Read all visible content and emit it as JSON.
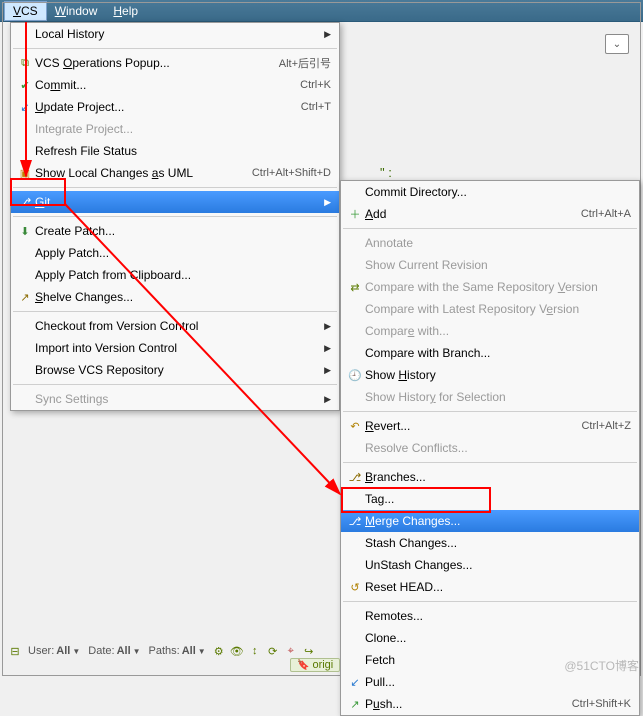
{
  "menubar": {
    "vcs": "VCS",
    "window": "Window",
    "help": "Help"
  },
  "vcs_menu": {
    "local_history": "Local History",
    "vcs_ops": "VCS Operations Popup...",
    "vcs_ops_sc": "Alt+后引号",
    "commit": "Commit...",
    "commit_sc": "Ctrl+K",
    "update": "Update Project...",
    "update_sc": "Ctrl+T",
    "integrate": "Integrate Project...",
    "refresh": "Refresh File Status",
    "uml": "Show Local Changes as UML",
    "uml_sc": "Ctrl+Alt+Shift+D",
    "git": "Git",
    "create_patch": "Create Patch...",
    "apply_patch": "Apply Patch...",
    "apply_clip": "Apply Patch from Clipboard...",
    "shelve": "Shelve Changes...",
    "checkout_vc": "Checkout from Version Control",
    "import_vc": "Import into Version Control",
    "browse_repo": "Browse VCS Repository",
    "sync": "Sync Settings"
  },
  "git_menu": {
    "commit_dir": "Commit Directory...",
    "add": "Add",
    "add_sc": "Ctrl+Alt+A",
    "annotate": "Annotate",
    "show_cur": "Show Current Revision",
    "cmp_same": "Compare with the Same Repository Version",
    "cmp_latest": "Compare with Latest Repository Version",
    "cmp_with": "Compare with...",
    "cmp_branch": "Compare with Branch...",
    "show_hist": "Show History",
    "show_hist_sel": "Show History for Selection",
    "revert": "Revert...",
    "revert_sc": "Ctrl+Alt+Z",
    "resolve": "Resolve Conflicts...",
    "branches": "Branches...",
    "tag": "Tag...",
    "merge": "Merge Changes...",
    "stash": "Stash Changes...",
    "unstash": "UnStash Changes...",
    "reset": "Reset HEAD...",
    "remotes": "Remotes...",
    "clone": "Clone...",
    "fetch": "Fetch",
    "pull": "Pull...",
    "push": "Push...",
    "push_sc": "Ctrl+Shift+K"
  },
  "bottom": {
    "user": "User:",
    "all": "All",
    "date": "Date:",
    "paths": "Paths:"
  },
  "bg_quote": "\" :",
  "origin": "origi",
  "watermark": "@51CTO博客"
}
